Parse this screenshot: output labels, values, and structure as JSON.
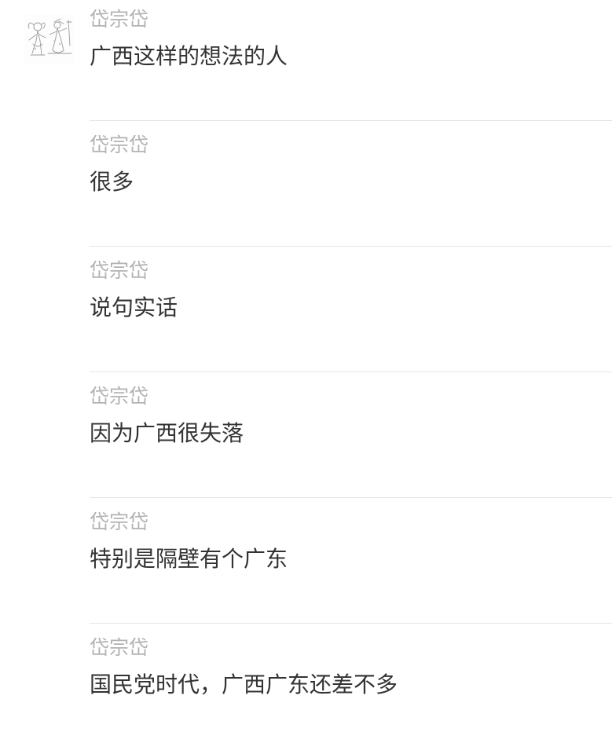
{
  "messages": [
    {
      "sender": "岱宗岱",
      "text": "广西这样的想法的人",
      "show_avatar": true
    },
    {
      "sender": "岱宗岱",
      "text": "很多",
      "show_avatar": false
    },
    {
      "sender": "岱宗岱",
      "text": "说句实话",
      "show_avatar": false
    },
    {
      "sender": "岱宗岱",
      "text": "因为广西很失落",
      "show_avatar": false
    },
    {
      "sender": "岱宗岱",
      "text": "特别是隔壁有个广东",
      "show_avatar": false
    },
    {
      "sender": "岱宗岱",
      "text": "国民党时代，广西广东还差不多",
      "show_avatar": false
    }
  ]
}
